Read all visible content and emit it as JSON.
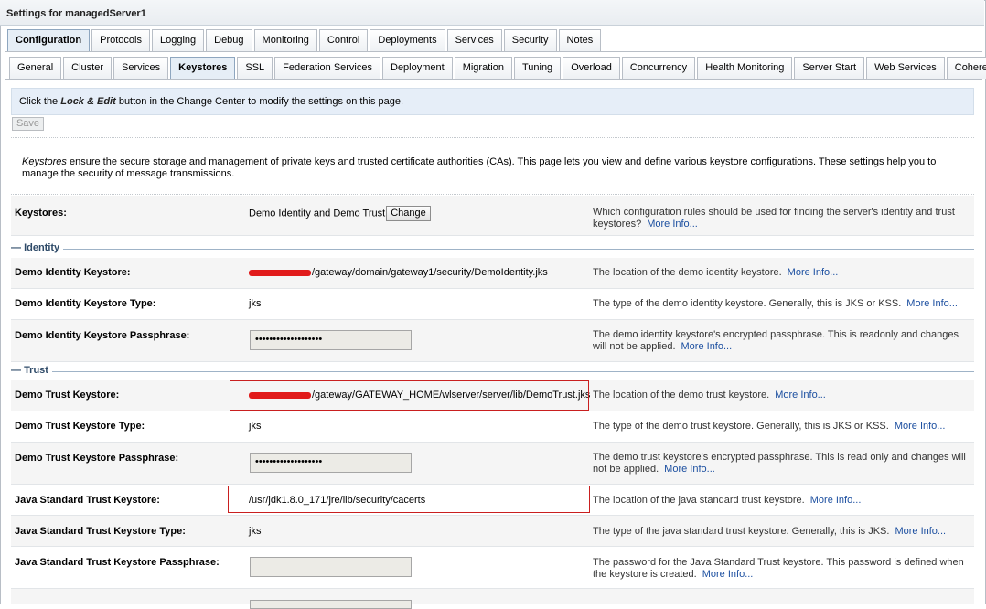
{
  "page": {
    "title": "Settings for managedServer1"
  },
  "main_tabs": [
    "Configuration",
    "Protocols",
    "Logging",
    "Debug",
    "Monitoring",
    "Control",
    "Deployments",
    "Services",
    "Security",
    "Notes"
  ],
  "sub_tabs": [
    "General",
    "Cluster",
    "Services",
    "Keystores",
    "SSL",
    "Federation Services",
    "Deployment",
    "Migration",
    "Tuning",
    "Overload",
    "Concurrency",
    "Health Monitoring",
    "Server Start",
    "Web Services",
    "Coherence"
  ],
  "info": {
    "prefix": "Click the ",
    "lock_edit": "Lock & Edit",
    "suffix": " button in the Change Center to modify the settings on this page."
  },
  "save_label": "Save",
  "intro": {
    "emph": "Keystores",
    "text": " ensure the secure storage and management of private keys and trusted certificate authorities (CAs). This page lets you view and define various keystore configurations. These settings help you to manage the security of message transmissions."
  },
  "more_info": "More Info...",
  "keystores": {
    "label": "Keystores:",
    "value": "Demo Identity and Demo Trust",
    "change_label": "Change",
    "desc": "Which configuration rules should be used for finding the server's identity and trust keystores?"
  },
  "identity": {
    "section": "Identity",
    "keystore": {
      "label": "Demo Identity Keystore:",
      "value": "/gateway/domain/gateway1/security/DemoIdentity.jks",
      "desc": "The location of the demo identity keystore."
    },
    "type": {
      "label": "Demo Identity Keystore Type:",
      "value": "jks",
      "desc": "The type of the demo identity keystore. Generally, this is JKS or KSS."
    },
    "pass": {
      "label": "Demo Identity Keystore Passphrase:",
      "value": "•••••••••••••••••••",
      "desc": "The demo identity keystore's encrypted passphrase. This is readonly and changes will not be applied."
    }
  },
  "trust": {
    "section": "Trust",
    "keystore": {
      "label": "Demo Trust Keystore:",
      "value": "/gateway/GATEWAY_HOME/wlserver/server/lib/DemoTrust.jks",
      "desc": "The location of the demo trust keystore."
    },
    "type": {
      "label": "Demo Trust Keystore Type:",
      "value": "jks",
      "desc": "The type of the demo trust keystore. Generally, this is JKS or KSS."
    },
    "pass": {
      "label": "Demo Trust Keystore Passphrase:",
      "value": "•••••••••••••••••••",
      "desc": "The demo trust keystore's encrypted passphrase. This is read only and changes will not be applied."
    },
    "java": {
      "label": "Java Standard Trust Keystore:",
      "value": "/usr/jdk1.8.0_171/jre/lib/security/cacerts",
      "desc": "The location of the java standard trust keystore."
    },
    "java_type": {
      "label": "Java Standard Trust Keystore Type:",
      "value": "jks",
      "desc": "The type of the java standard trust keystore. Generally, this is JKS."
    },
    "java_pass": {
      "label": "Java Standard Trust Keystore Passphrase:",
      "value": "",
      "desc": "The password for the Java Standard Trust keystore. This password is defined when the keystore is created."
    }
  }
}
